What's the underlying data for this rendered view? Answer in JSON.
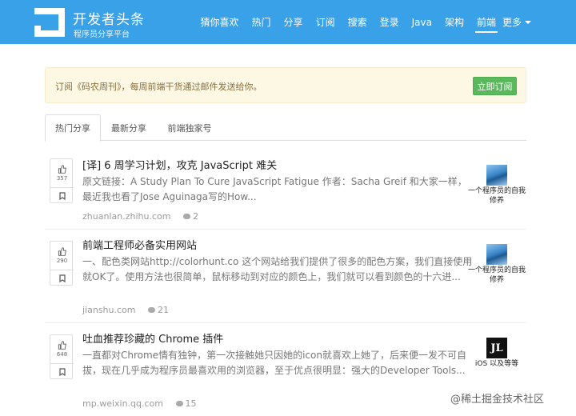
{
  "header": {
    "brand_title": "开发者头条",
    "brand_subtitle": "程序员分享平台",
    "nav": [
      "猜你喜欢",
      "热门",
      "分享",
      "订阅",
      "搜索",
      "登录",
      "Java",
      "架构",
      "前端"
    ],
    "active_nav": "前端",
    "more_label": "更多"
  },
  "banner": {
    "text": "订阅《码农周刊》，每周前端干货通过邮件发送给你。",
    "button_label": "立即订阅"
  },
  "tabs": {
    "items": [
      "热门分享",
      "最新分享",
      "前端独家号"
    ],
    "active": "热门分享"
  },
  "articles": [
    {
      "votes": "357",
      "title": "[译] 6 周学习计划，攻克 JavaScript 难关",
      "summary": "原文链接：A Study Plan To Cure JavaScript Fatigue 作者：Sacha Greif 和大家一样，最近我也看了Jose Aguinaga写的How...",
      "source": "zhuanlan.zhihu.com",
      "comments": "2",
      "author": "一个程序员的自我修养"
    },
    {
      "votes": "290",
      "title": "前端工程师必备实用网站",
      "summary": "一、配色类网站http://colorhunt.co 这个网站给我们提供了很多的配色方案，我们直接使用就OK了。使用方法也很简单，鼠标移动到对应的颜色上，我们就可以看到颜色的十六进...",
      "source": "jianshu.com",
      "comments": "21",
      "author": "一个程序员的自我修养"
    },
    {
      "votes": "648",
      "title": "吐血推荐珍藏的 Chrome 插件",
      "summary": "一直都对Chrome情有独钟，第一次接触她只因她的icon就喜欢上她了，后来便一发不可自拔，现在几乎成为程序员最喜欢用的浏览器，至于优点很明显：强大的Developer Tools...",
      "source": "mp.weixin.qq.com",
      "comments": "15",
      "author": "iOS 以及等等",
      "author_logo": "JL"
    }
  ],
  "watermark": "@稀土掘金技术社区",
  "colors": {
    "navbar": "#39a1e8",
    "banner_bg": "#fcf8e3",
    "subscribe_button": "#5cb85c"
  }
}
